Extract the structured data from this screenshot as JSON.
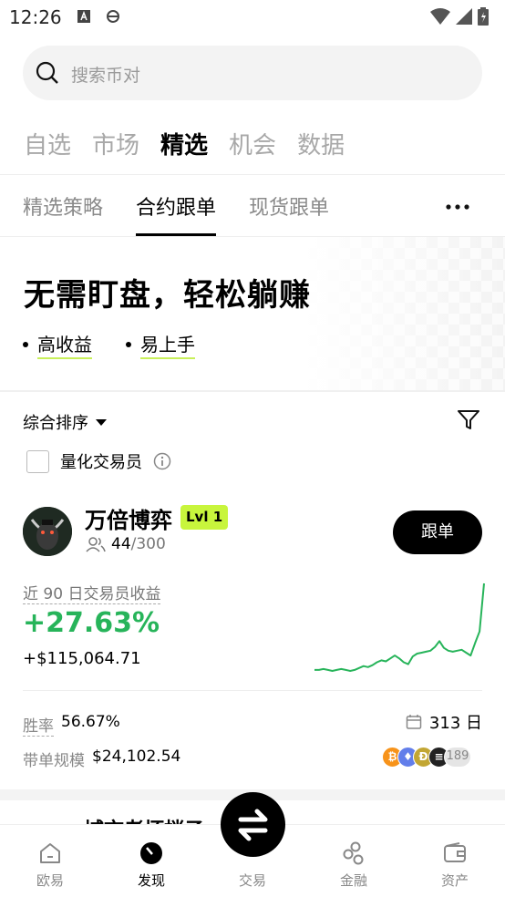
{
  "status_bar": {
    "time": "12:26"
  },
  "search": {
    "placeholder": "搜索币对"
  },
  "top_tabs": [
    "自选",
    "市场",
    "精选",
    "机会",
    "数据"
  ],
  "sub_tabs": [
    "精选策略",
    "合约跟单",
    "现货跟单"
  ],
  "banner": {
    "title": "无需盯盘，轻松躺赚",
    "bullets": [
      "高收益",
      "易上手"
    ]
  },
  "filters": {
    "sort_label": "综合排序",
    "quant_label": "量化交易员"
  },
  "trader": {
    "name": "万倍博弈",
    "level": "Lvl 1",
    "followers": "44",
    "followers_max": "/300",
    "follow_button": "跟单",
    "pnl_label": "近 90 日交易员收益",
    "pnl_percent": "+27.63%",
    "pnl_usd": "+$115,064.71",
    "win_rate_label": "胜率",
    "win_rate": "56.67%",
    "days": "313 日",
    "aum_label": "带单规模",
    "aum": "$24,102.54",
    "coins_more": "189",
    "sparkline": [
      0.1,
      0.1,
      0.11,
      0.1,
      0.09,
      0.1,
      0.11,
      0.1,
      0.09,
      0.1,
      0.12,
      0.14,
      0.13,
      0.15,
      0.18,
      0.2,
      0.19,
      0.22,
      0.25,
      0.22,
      0.18,
      0.16,
      0.24,
      0.27,
      0.28,
      0.29,
      0.3,
      0.34,
      0.4,
      0.33,
      0.3,
      0.29,
      0.3,
      0.31,
      0.28,
      0.25,
      0.38,
      0.5,
      1.0
    ]
  },
  "next_card_peek": "城市老坏梢子",
  "bottom_nav": [
    "欧易",
    "发现",
    "交易",
    "金融",
    "资产"
  ],
  "colors": {
    "accent_green": "#27b45a",
    "lvl_badge": "#c8f53c",
    "highlight": "#c8f05a"
  }
}
